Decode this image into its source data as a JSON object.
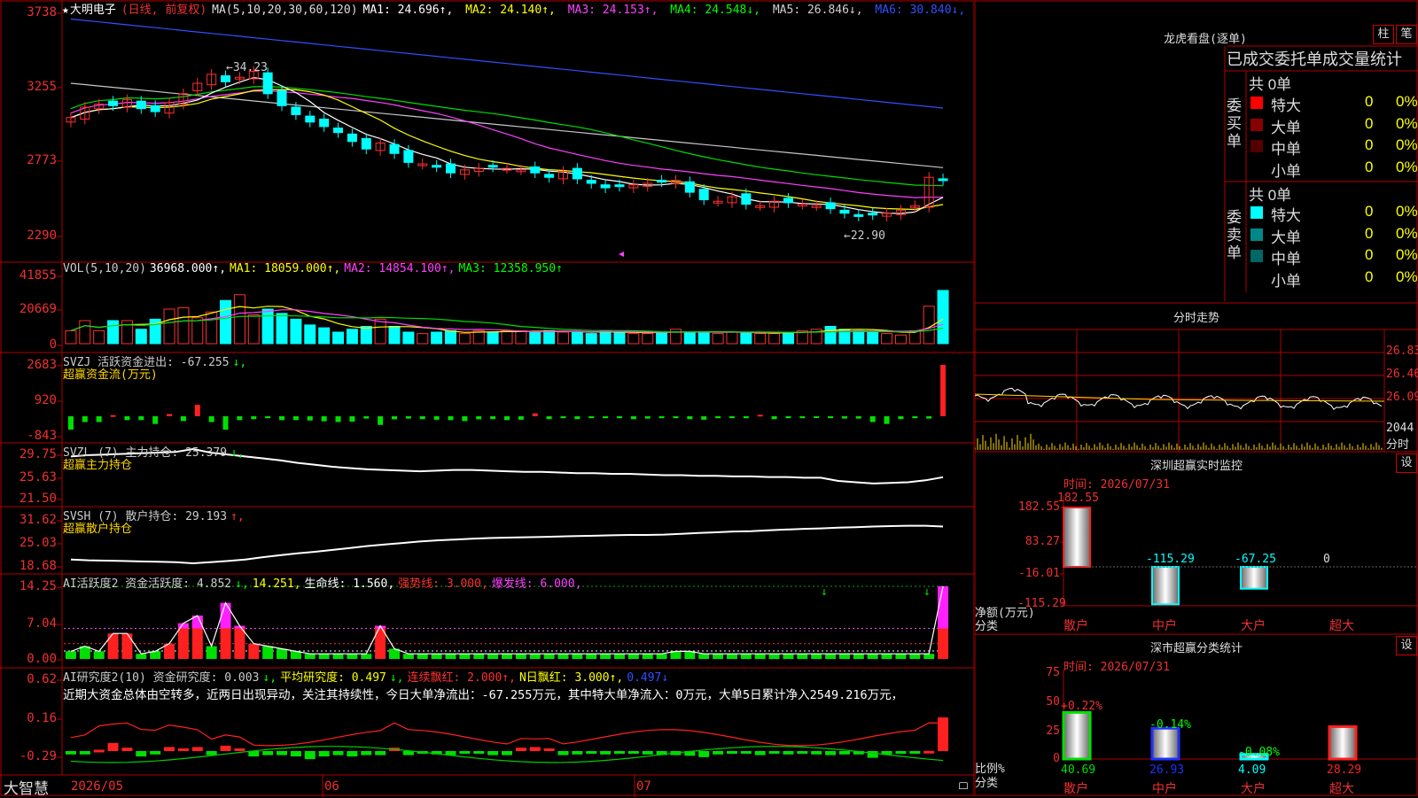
{
  "app": {
    "brand": "大智慧"
  },
  "price_panel": {
    "star": "★",
    "stock_name": "大明电子",
    "mode": "(日线, 前复权)",
    "ma_title": "MA(5,10,20,30,60,120)",
    "ma": [
      {
        "label": "MA1: 24.696",
        "arrow": "↑",
        "color": "#ffffff"
      },
      {
        "label": "MA2: 24.140",
        "arrow": "↑",
        "color": "#ffff00"
      },
      {
        "label": "MA3: 24.153",
        "arrow": "↑",
        "color": "#ff40ff"
      },
      {
        "label": "MA4: 24.548",
        "arrow": "↓",
        "color": "#00ff00"
      },
      {
        "label": "MA5: 26.846",
        "arrow": "↓",
        "color": "#d0d0d0"
      },
      {
        "label": "MA6: 30.840",
        "arrow": "↓",
        "color": "#3050ff"
      }
    ],
    "y_ticks": [
      "3738",
      "3255",
      "2773",
      "2290"
    ],
    "high_marker": "34.23",
    "low_marker": "22.90"
  },
  "vol_panel": {
    "legend": [
      {
        "text": "VOL(5,10,20)",
        "color": "#cccccc"
      },
      {
        "text": "36968.000↑,",
        "color": "#ffffff"
      },
      {
        "text": "MA1: 18059.000↑,",
        "color": "#ffff00"
      },
      {
        "text": "MA2: 14854.100↑,",
        "color": "#ff40ff"
      },
      {
        "text": "MA3: 12358.950↑",
        "color": "#00ff00"
      }
    ],
    "y_ticks": [
      "41855",
      "20669",
      "0"
    ]
  },
  "svzj_panel": {
    "legend": [
      {
        "text": "SVZJ  活跃资金进出: -67.255",
        "color": "#cccccc"
      },
      {
        "text": "↓,",
        "color": "#00ff00"
      }
    ],
    "subtitle": "超赢资金流(万元)",
    "y_ticks": [
      "2683",
      "920",
      "-843"
    ]
  },
  "svzl_panel": {
    "legend": [
      {
        "text": "SVZL (7) 主力持仓: 25.379",
        "color": "#cccccc"
      },
      {
        "text": "↓,",
        "color": "#00ff00"
      }
    ],
    "subtitle": "超赢主力持仓",
    "y_ticks": [
      "29.75",
      "25.63",
      "21.50"
    ]
  },
  "svsh_panel": {
    "legend": [
      {
        "text": "SVSH (7) 散户持仓: 29.193",
        "color": "#cccccc"
      },
      {
        "text": "↑,",
        "color": "#ff3030"
      }
    ],
    "subtitle": "超赢散户持仓",
    "y_ticks": [
      "31.62",
      "25.03",
      "18.68"
    ]
  },
  "ai_active_panel": {
    "legend": [
      {
        "text": "AI活跃度2 资金活跃度: 4.852",
        "color": "#cccccc"
      },
      {
        "text": "↓,",
        "color": "#00ff00"
      },
      {
        "text": "14.251,",
        "color": "#ffff00"
      },
      {
        "text": "生命线: 1.560,",
        "color": "#ffffff"
      },
      {
        "text": "强势线: 3.000,",
        "color": "#ff3030"
      },
      {
        "text": "爆发线: 6.000,",
        "color": "#ff40ff"
      }
    ],
    "y_ticks": [
      "14.25",
      "7.04",
      "0.00"
    ]
  },
  "ai_research_panel": {
    "legend": [
      {
        "text": "AI研究度2(10) 资金研究度: 0.003",
        "color": "#cccccc"
      },
      {
        "text": "↓,",
        "color": "#00ff00"
      },
      {
        "text": "平均研究度: 0.497",
        "color": "#ffff00"
      },
      {
        "text": "↓,",
        "color": "#00ff00"
      },
      {
        "text": "连续飘红: 2.000↑,",
        "color": "#ff3030"
      },
      {
        "text": "N日飘红: 3.000↑,",
        "color": "#ffff00"
      },
      {
        "text": "0.497↓",
        "color": "#3050ff"
      }
    ],
    "comment": "近期大资金总体由空转多，近两日出现异动，关注其持续性，今日大单净流出：-67.255万元，其中特大单净流入：0万元，大单5日累计净入2549.216万元，",
    "y_ticks": [
      "0.62",
      "0.16",
      "-0.29"
    ]
  },
  "x_axis": {
    "labels": [
      "2026/05",
      "06",
      "07"
    ]
  },
  "dragon": {
    "title": "龙虎看盘(逐单)",
    "btn_zhu": "柱",
    "btn_bi": "笔",
    "header": "已成交委托单成交量统计",
    "buy_label": "委买单",
    "sell_label": "委卖单",
    "buy_total": "共 0单",
    "sell_total": "共 0单",
    "buy_rows": [
      {
        "name": "特大",
        "count": "0",
        "pct": "0%",
        "color": "#ff0000"
      },
      {
        "name": "大单",
        "count": "0",
        "pct": "0%",
        "color": "#880000"
      },
      {
        "name": "中单",
        "count": "0",
        "pct": "0%",
        "color": "#550000"
      },
      {
        "name": "小单",
        "count": "0",
        "pct": "0%",
        "color": ""
      }
    ],
    "sell_rows": [
      {
        "name": "特大",
        "count": "0",
        "pct": "0%",
        "color": "#00ffff"
      },
      {
        "name": "大单",
        "count": "0",
        "pct": "0%",
        "color": "#008888"
      },
      {
        "name": "中单",
        "count": "0",
        "pct": "0%",
        "color": "#006666"
      },
      {
        "name": "小单",
        "count": "0",
        "pct": "0%",
        "color": ""
      }
    ]
  },
  "minute": {
    "title": "分时走势",
    "prices": [
      "26.83",
      "26.46",
      "26.09"
    ],
    "vol_label": "2044",
    "bottom_label": "分时"
  },
  "monitor": {
    "title": "深圳超赢实时监控",
    "btn": "设",
    "time": "时间: 2026/07/31",
    "y_ticks": [
      "182.55",
      "83.27",
      "-16.01",
      "-115.29"
    ],
    "axis_label_1": "净额(万元)",
    "axis_label_2": "分类",
    "bars": [
      {
        "cat": "散户",
        "value": "182.55"
      },
      {
        "cat": "中户",
        "value": "-115.29"
      },
      {
        "cat": "大户",
        "value": "-67.25"
      },
      {
        "cat": "超大",
        "value": "0"
      }
    ]
  },
  "classify": {
    "title": "深市超赢分类统计",
    "btn": "设",
    "time": "时间: 2026/07/31",
    "y_ticks": [
      "75",
      "50",
      "25",
      "0"
    ],
    "axis_label_1": "比例%",
    "axis_label_2": "分类",
    "bars": [
      {
        "cat": "散户",
        "value": "40.69",
        "change": "+0.22%"
      },
      {
        "cat": "中户",
        "value": "26.93",
        "change": "-0.14%"
      },
      {
        "cat": "大户",
        "value": "4.09",
        "change": "-0.08%"
      },
      {
        "cat": "超大",
        "value": "28.29",
        "change": ""
      }
    ]
  },
  "chart_data": [
    {
      "type": "candlestick",
      "title": "大明电子 (日线, 前复权)",
      "y_range": [
        22.9,
        37.38
      ],
      "close": [
        30.2,
        30.9,
        31.1,
        31.0,
        31.4,
        30.8,
        30.6,
        31.2,
        31.8,
        32.5,
        33.1,
        32.6,
        32.9,
        33.3,
        31.8,
        31.0,
        30.4,
        29.9,
        29.6,
        29.2,
        28.6,
        28.1,
        28.5,
        27.8,
        27.2,
        27.1,
        26.9,
        26.5,
        26.7,
        26.8,
        26.9,
        26.8,
        26.7,
        26.5,
        26.2,
        26.6,
        26.1,
        25.8,
        25.5,
        25.6,
        25.7,
        25.8,
        25.9,
        26.0,
        25.2,
        24.7,
        24.6,
        24.9,
        24.4,
        24.3,
        24.6,
        24.5,
        24.4,
        24.3,
        24.1,
        23.8,
        23.6,
        23.7,
        23.8,
        24.0,
        24.3,
        26.2,
        26.0
      ],
      "ma_current": {
        "MA1": 24.696,
        "MA2": 24.14,
        "MA3": 24.153,
        "MA4": 24.548,
        "MA5": 26.846,
        "MA6": 30.84
      }
    },
    {
      "type": "bar",
      "title": "VOL(5,10,20)",
      "values": [
        9000,
        16000,
        9000,
        16000,
        16000,
        10000,
        17000,
        24000,
        25000,
        18000,
        22000,
        30000,
        34000,
        20000,
        24000,
        21000,
        17000,
        13000,
        11000,
        8000,
        10000,
        12000,
        17000,
        12000,
        8000,
        7000,
        8000,
        9000,
        7000,
        9000,
        8000,
        9000,
        9000,
        8000,
        9000,
        8000,
        8000,
        7000,
        9000,
        8000,
        7000,
        7000,
        8000,
        10000,
        8000,
        8000,
        7000,
        8000,
        8000,
        7000,
        7000,
        8000,
        9000,
        10000,
        12000,
        10000,
        9000,
        8000,
        7000,
        6000,
        9000,
        26000,
        36968
      ],
      "y_range": [
        0,
        41855
      ]
    },
    {
      "type": "bar",
      "title": "SVZJ 活跃资金进出",
      "values": [
        -700,
        -300,
        -300,
        60,
        -200,
        -200,
        -400,
        120,
        -250,
        600,
        -300,
        -700,
        -200,
        -150,
        -100,
        -200,
        -200,
        -220,
        -260,
        -300,
        -280,
        -120,
        -450,
        -160,
        -120,
        -150,
        -180,
        -200,
        -250,
        -160,
        -150,
        -200,
        -180,
        150,
        -150,
        -100,
        -150,
        -100,
        -100,
        -100,
        -150,
        -120,
        -100,
        -100,
        -150,
        -180,
        -100,
        -100,
        -100,
        80,
        -150,
        -100,
        -100,
        -80,
        -100,
        -120,
        -120,
        -300,
        -400,
        -150,
        -100,
        -120,
        2683,
        -67.255
      ],
      "y_range": [
        -843,
        2683
      ]
    },
    {
      "type": "line",
      "title": "SVZL (7) 主力持仓",
      "values": [
        28.6,
        28.8,
        28.9,
        29.0,
        29.1,
        29.2,
        29.3,
        29.75,
        29.2,
        28.9,
        28.6,
        28.3,
        28.0,
        27.6,
        27.3,
        27.0,
        26.8,
        26.6,
        26.5,
        26.4,
        26.3,
        26.4,
        26.5,
        26.5,
        26.4,
        26.3,
        26.2,
        26.2,
        26.1,
        26.0,
        26.0,
        25.9,
        25.9,
        25.8,
        25.7,
        25.7,
        25.6,
        25.6,
        25.5,
        25.5,
        25.4,
        25.4,
        25.3,
        25.3,
        24.8,
        24.6,
        24.4,
        24.5,
        24.6,
        24.9,
        25.379
      ],
      "y_range": [
        21.5,
        29.75
      ]
    },
    {
      "type": "line",
      "title": "SVSH (7) 散户持仓",
      "values": [
        20.6,
        20.4,
        20.3,
        20.2,
        20.1,
        20.0,
        19.9,
        19.6,
        19.9,
        20.2,
        20.6,
        21.2,
        21.7,
        22.2,
        22.6,
        23.1,
        23.6,
        24.1,
        24.5,
        24.9,
        25.3,
        25.6,
        25.8,
        26.0,
        26.2,
        26.3,
        26.4,
        26.5,
        26.6,
        26.7,
        26.8,
        26.9,
        27.0,
        27.0,
        27.1,
        27.3,
        27.5,
        27.7,
        27.9,
        28.0,
        28.2,
        28.4,
        28.6,
        28.7,
        28.9,
        29.0,
        29.2,
        29.3,
        29.4,
        29.4,
        29.193
      ],
      "y_range": [
        18.68,
        31.62
      ]
    },
    {
      "type": "bar",
      "title": "AI活跃度2 资金活跃度",
      "values": [
        1.5,
        2.5,
        1.5,
        5.0,
        5.0,
        1.0,
        1.5,
        3.0,
        7.0,
        8.5,
        2.5,
        11.0,
        6.5,
        3.0,
        2.5,
        2.0,
        1.5,
        1.0,
        1.0,
        1.0,
        1.0,
        1.0,
        6.5,
        2.0,
        1.0,
        1.0,
        1.0,
        1.0,
        1.0,
        1.0,
        1.0,
        1.0,
        1.0,
        1.0,
        1.0,
        1.0,
        1.0,
        1.0,
        1.0,
        1.0,
        1.0,
        1.0,
        1.0,
        1.5,
        1.5,
        1.0,
        1.0,
        1.0,
        1.0,
        1.0,
        1.0,
        1.0,
        1.0,
        1.0,
        1.0,
        1.0,
        1.0,
        1.0,
        1.0,
        1.0,
        1.0,
        1.0,
        14.251,
        4.852
      ],
      "y_range": [
        0.0,
        14.25
      ],
      "reference_lines": {
        "生命线": 1.56,
        "强势线": 3.0,
        "爆发线": 6.0
      }
    },
    {
      "type": "bar",
      "title": "AI研究度2(10) 资金研究度",
      "values": [
        -0.05,
        -0.05,
        0.02,
        0.12,
        0.05,
        -0.08,
        -0.05,
        0.06,
        0.04,
        0.06,
        -0.06,
        0.08,
        0.04,
        -0.08,
        -0.06,
        -0.06,
        -0.08,
        -0.12,
        -0.08,
        -0.06,
        -0.08,
        -0.06,
        -0.06,
        0.05,
        -0.06,
        -0.03,
        -0.05,
        -0.06,
        -0.04,
        -0.02,
        -0.06,
        -0.06,
        0.05,
        0.06,
        0.04,
        -0.06,
        -0.05,
        -0.04,
        -0.05,
        -0.04,
        -0.03,
        -0.05,
        -0.06,
        -0.06,
        -0.07,
        -0.09,
        -0.05,
        -0.04,
        -0.03,
        -0.06,
        -0.04,
        -0.05,
        -0.04,
        -0.05,
        -0.06,
        -0.05,
        -0.05,
        -0.1,
        -0.05,
        -0.04,
        -0.02,
        0.003,
        0.5,
        0.003
      ],
      "y_range": [
        -0.29,
        0.62
      ]
    }
  ]
}
